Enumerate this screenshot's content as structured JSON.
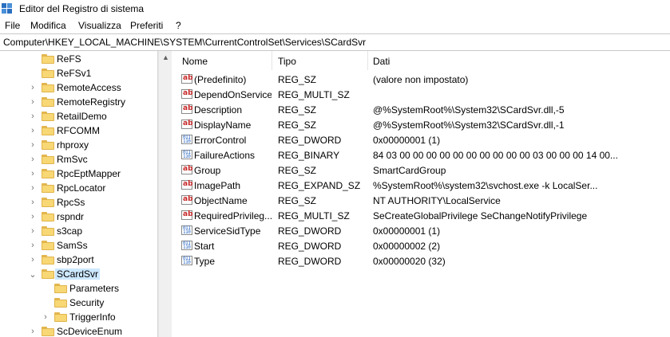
{
  "window": {
    "title": "Editor del Registro di sistema",
    "icon": "registry-icon"
  },
  "menu": [
    "File",
    "Modifica",
    "Visualizza",
    "Preferiti",
    "?"
  ],
  "address": "Computer\\HKEY_LOCAL_MACHINE\\SYSTEM\\CurrentControlSet\\Services\\SCardSvr",
  "tree": [
    {
      "label": "ReFS",
      "expandable": false
    },
    {
      "label": "ReFSv1",
      "expandable": false
    },
    {
      "label": "RemoteAccess",
      "expandable": true
    },
    {
      "label": "RemoteRegistry",
      "expandable": true
    },
    {
      "label": "RetailDemo",
      "expandable": true
    },
    {
      "label": "RFCOMM",
      "expandable": true
    },
    {
      "label": "rhproxy",
      "expandable": true
    },
    {
      "label": "RmSvc",
      "expandable": true
    },
    {
      "label": "RpcEptMapper",
      "expandable": true
    },
    {
      "label": "RpcLocator",
      "expandable": true
    },
    {
      "label": "RpcSs",
      "expandable": true
    },
    {
      "label": "rspndr",
      "expandable": true
    },
    {
      "label": "s3cap",
      "expandable": true
    },
    {
      "label": "SamSs",
      "expandable": true
    },
    {
      "label": "sbp2port",
      "expandable": true
    },
    {
      "label": "SCardSvr",
      "expandable": true,
      "expanded": true,
      "selected": true
    },
    {
      "label": "Parameters",
      "expandable": false,
      "child": true
    },
    {
      "label": "Security",
      "expandable": false,
      "child": true
    },
    {
      "label": "TriggerInfo",
      "expandable": true,
      "child": true
    },
    {
      "label": "ScDeviceEnum",
      "expandable": true
    }
  ],
  "columns": {
    "name": "Nome",
    "type": "Tipo",
    "data": "Dati"
  },
  "values": [
    {
      "icon": "string-value-icon",
      "name": "(Predefinito)",
      "type": "REG_SZ",
      "data": "(valore non impostato)"
    },
    {
      "icon": "string-value-icon",
      "name": "DependOnService",
      "type": "REG_MULTI_SZ",
      "data": ""
    },
    {
      "icon": "string-value-icon",
      "name": "Description",
      "type": "REG_SZ",
      "data": "@%SystemRoot%\\System32\\SCardSvr.dll,-5"
    },
    {
      "icon": "string-value-icon",
      "name": "DisplayName",
      "type": "REG_SZ",
      "data": "@%SystemRoot%\\System32\\SCardSvr.dll,-1"
    },
    {
      "icon": "binary-value-icon",
      "name": "ErrorControl",
      "type": "REG_DWORD",
      "data": "0x00000001 (1)"
    },
    {
      "icon": "binary-value-icon",
      "name": "FailureActions",
      "type": "REG_BINARY",
      "data": "84 03 00 00 00 00 00 00 00 00 00 00 03 00 00 00 14 00..."
    },
    {
      "icon": "string-value-icon",
      "name": "Group",
      "type": "REG_SZ",
      "data": "SmartCardGroup"
    },
    {
      "icon": "string-value-icon",
      "name": "ImagePath",
      "type": "REG_EXPAND_SZ",
      "data": "%SystemRoot%\\system32\\svchost.exe -k LocalSer..."
    },
    {
      "icon": "string-value-icon",
      "name": "ObjectName",
      "type": "REG_SZ",
      "data": "NT AUTHORITY\\LocalService"
    },
    {
      "icon": "string-value-icon",
      "name": "RequiredPrivileg...",
      "type": "REG_MULTI_SZ",
      "data": "SeCreateGlobalPrivilege SeChangeNotifyPrivilege"
    },
    {
      "icon": "binary-value-icon",
      "name": "ServiceSidType",
      "type": "REG_DWORD",
      "data": "0x00000001 (1)"
    },
    {
      "icon": "binary-value-icon",
      "name": "Start",
      "type": "REG_DWORD",
      "data": "0x00000002 (2)"
    },
    {
      "icon": "binary-value-icon",
      "name": "Type",
      "type": "REG_DWORD",
      "data": "0x00000020 (32)"
    }
  ],
  "colors": {
    "selection": "#cce8ff",
    "folder": "#f8d775",
    "string_icon": "#c62828",
    "binary_icon": "#1f5fbf"
  }
}
